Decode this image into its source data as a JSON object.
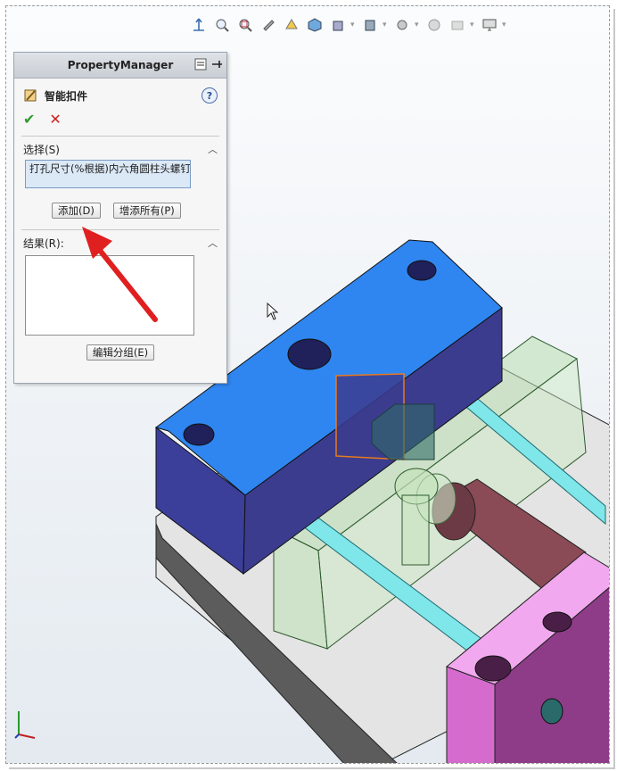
{
  "property_manager": {
    "title": "PropertyManager",
    "feature_name": "智能扣件",
    "help_glyph": "?",
    "ok_glyph": "✔",
    "cancel_glyph": "✕",
    "selection": {
      "header": "选择(S)",
      "value": "打孔尺寸(%根据)内六角圆柱头螺钉",
      "add_button": "添加(D)",
      "add_all_button": "增添所有(P)"
    },
    "results": {
      "header": "结果(R):",
      "edit_group_button": "编辑分组(E)"
    }
  },
  "heads_up_toolbar": {
    "icons": [
      "view-orientation-icon",
      "zoom-to-fit-icon",
      "zoom-to-area-icon",
      "previous-view-icon",
      "section-view-icon",
      "view-selector-icon",
      "display-style-icon",
      "hide-show-items-icon",
      "edit-appearance-icon",
      "apply-scene-icon",
      "view-settings-icon"
    ]
  },
  "annotation": {
    "arrow_color": "#e02020"
  },
  "colors": {
    "top_plate": "#2f86f0",
    "top_plate_side": "#3b3f9a",
    "base_plate": "#5a5a5a",
    "pink_block": "#e07ad8",
    "guide_pin": "#7fe6ea",
    "transparent_part": "#b9dfb0",
    "cylinder": "#8a4b56"
  }
}
